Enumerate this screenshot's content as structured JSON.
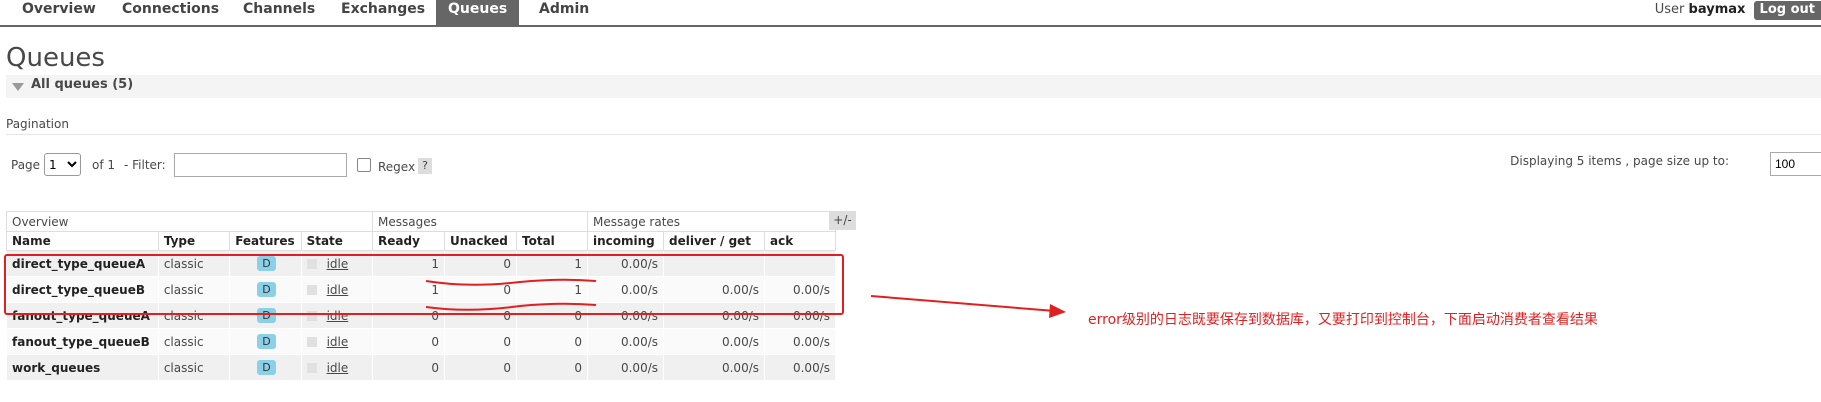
{
  "nav": {
    "tabs": [
      "Overview",
      "Connections",
      "Channels",
      "Exchanges",
      "Queues",
      "Admin"
    ],
    "active": "Queues",
    "user_label": "User",
    "user_name": "baymax",
    "logout": "Log out"
  },
  "page_title": "Queues",
  "section": {
    "label": "All queues (5)"
  },
  "pagination": {
    "label": "Pagination",
    "page_label": "Page",
    "page_value": "1",
    "of_label": "of 1",
    "filter_label": "- Filter:",
    "filter_value": "",
    "regex_label": "Regex",
    "help": "?",
    "displaying": "Displaying 5 items , page size up to:",
    "page_size": "100"
  },
  "table": {
    "groups": [
      "Overview",
      "Messages",
      "Message rates"
    ],
    "toggle": "+/-",
    "columns": [
      "Name",
      "Type",
      "Features",
      "State",
      "Ready",
      "Unacked",
      "Total",
      "incoming",
      "deliver / get",
      "ack"
    ],
    "rows": [
      {
        "name": "direct_type_queueA",
        "type": "classic",
        "feature": "D",
        "state": "idle",
        "ready": "1",
        "unacked": "0",
        "total": "1",
        "incoming": "0.00/s",
        "deliver": "",
        "ack": ""
      },
      {
        "name": "direct_type_queueB",
        "type": "classic",
        "feature": "D",
        "state": "idle",
        "ready": "1",
        "unacked": "0",
        "total": "1",
        "incoming": "0.00/s",
        "deliver": "0.00/s",
        "ack": "0.00/s"
      },
      {
        "name": "fanout_type_queueA",
        "type": "classic",
        "feature": "D",
        "state": "idle",
        "ready": "0",
        "unacked": "0",
        "total": "0",
        "incoming": "0.00/s",
        "deliver": "0.00/s",
        "ack": "0.00/s"
      },
      {
        "name": "fanout_type_queueB",
        "type": "classic",
        "feature": "D",
        "state": "idle",
        "ready": "0",
        "unacked": "0",
        "total": "0",
        "incoming": "0.00/s",
        "deliver": "0.00/s",
        "ack": "0.00/s"
      },
      {
        "name": "work_queues",
        "type": "classic",
        "feature": "D",
        "state": "idle",
        "ready": "0",
        "unacked": "0",
        "total": "0",
        "incoming": "0.00/s",
        "deliver": "0.00/s",
        "ack": "0.00/s"
      }
    ]
  },
  "annotation": "error级别的日志既要保存到数据库，又要打印到控制台，下面启动消费者查看结果",
  "colors": {
    "annotation_red": "#e02020",
    "nav_active": "#666666",
    "feature_badge": "#8cd0e8"
  }
}
